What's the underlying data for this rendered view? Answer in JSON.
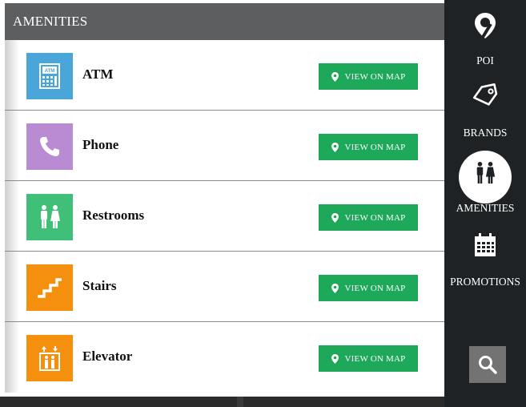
{
  "header": {
    "title": "AMENITIES"
  },
  "amenities": [
    {
      "label": "ATM",
      "icon": "atm-icon",
      "color": "#4aa6d8",
      "button_label": "VIEW ON MAP"
    },
    {
      "label": "Phone",
      "icon": "phone-icon",
      "color": "#b98bd3",
      "button_label": "VIEW ON MAP"
    },
    {
      "label": "Restrooms",
      "icon": "restrooms-icon",
      "color": "#3fbf77",
      "button_label": "VIEW ON MAP"
    },
    {
      "label": "Stairs",
      "icon": "stairs-icon",
      "color": "#f5900e",
      "button_label": "VIEW ON MAP"
    },
    {
      "label": "Elevator",
      "icon": "elevator-icon",
      "color": "#f5900e",
      "button_label": "VIEW ON MAP"
    }
  ],
  "sidebar": {
    "items": [
      {
        "label": "POI",
        "icon": "map-pin-icon",
        "active": false
      },
      {
        "label": "BRANDS",
        "icon": "tag-icon",
        "active": false
      },
      {
        "label": "AMENITIES",
        "icon": "restrooms-icon",
        "active": true
      },
      {
        "label": "PROMOTIONS",
        "icon": "calendar-icon",
        "active": false
      }
    ],
    "search_icon": "search-icon"
  },
  "colors": {
    "header_bg": "#5c5e60",
    "sidebar_bg": "#1f2224",
    "button_green": "#1ea85a"
  }
}
